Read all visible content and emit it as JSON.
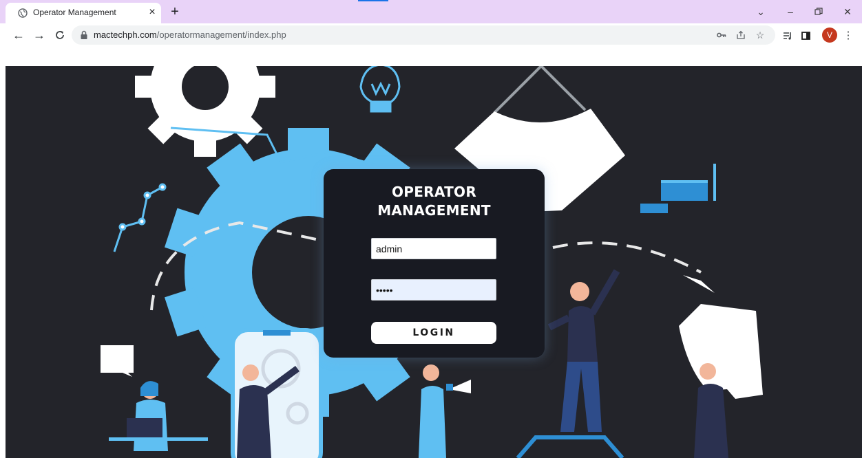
{
  "browser": {
    "tab_title": "Operator Management",
    "tab_close": "×",
    "new_tab": "+",
    "url_host": "mactechph.com",
    "url_path": "/operatormanagement/index.php",
    "profile_initial": "V",
    "profile_color": "#c5381e",
    "icons": [
      "back-icon",
      "forward-icon",
      "reload-icon",
      "lock-icon",
      "key-icon",
      "share-icon",
      "star-icon",
      "reading-list-icon",
      "side-panel-icon",
      "menu-icon"
    ]
  },
  "login": {
    "title_line1": "OPERATOR",
    "title_line2": "MANAGEMENT",
    "username_value": "admin",
    "password_value": "•••••",
    "button_label": "LOGIN"
  },
  "colors": {
    "tabstrip": "#e9d3f8",
    "page_background": "#23242a",
    "card_background": "#181a22",
    "gear_blue": "#5fbff2"
  }
}
